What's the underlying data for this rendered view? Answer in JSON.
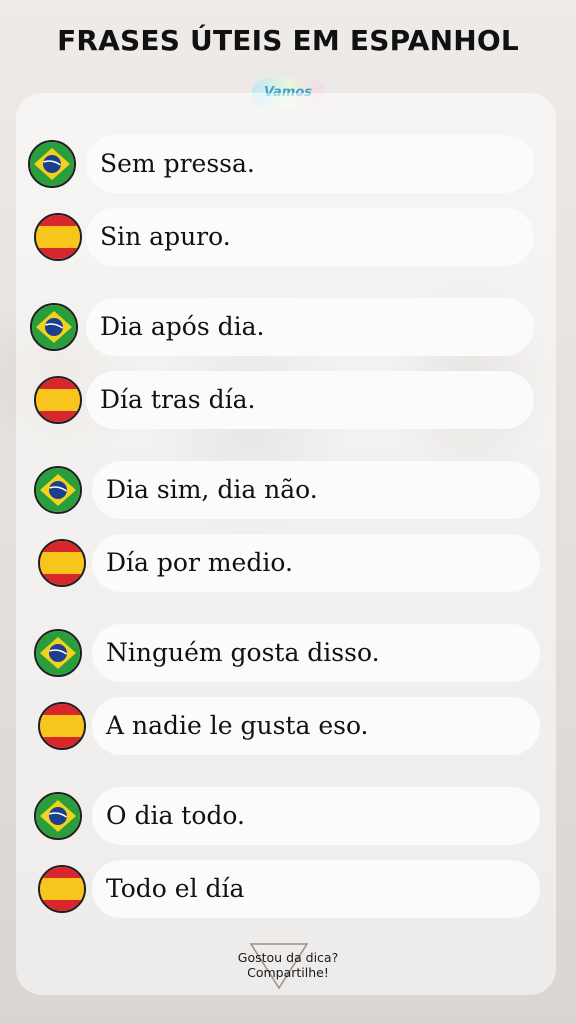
{
  "title": "FRASES ÚTEIS EM ESPANHOL",
  "logo_text": "Vamos",
  "phrases": [
    {
      "flag": "brazil-flag-icon",
      "text": "Sem pressa."
    },
    {
      "flag": "spain-flag-icon",
      "text": "Sin apuro."
    },
    {
      "flag": "brazil-flag-icon",
      "text": "Dia após dia."
    },
    {
      "flag": "spain-flag-icon",
      "text": "Día tras día."
    },
    {
      "flag": "brazil-flag-icon",
      "text": "Dia sim, dia não."
    },
    {
      "flag": "spain-flag-icon",
      "text": "Día por medio."
    },
    {
      "flag": "brazil-flag-icon",
      "text": "Ninguém gosta disso."
    },
    {
      "flag": "spain-flag-icon",
      "text": "A nadie le gusta eso."
    },
    {
      "flag": "brazil-flag-icon",
      "text": "O dia todo."
    },
    {
      "flag": "spain-flag-icon",
      "text": "Todo el día"
    }
  ],
  "footer": {
    "line1": "Gostou da dica?",
    "line2": "Compartilhe!"
  },
  "colors": {
    "brazil_green": "#2a9d3c",
    "brazil_yellow": "#f2d21b",
    "brazil_blue": "#1d3f8f",
    "spain_red": "#d8262d",
    "spain_yellow": "#f7c51c"
  }
}
